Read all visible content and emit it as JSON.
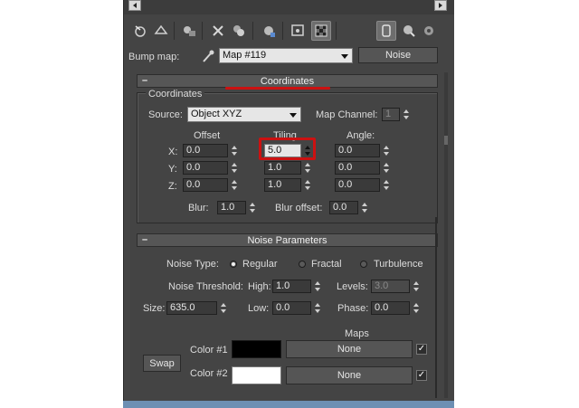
{
  "colors": {
    "panel": "#444444",
    "highlight_red": "#cc1111",
    "taskbar": "#6d8fb3"
  },
  "toolbar": {
    "icons": [
      "go-to-parent-icon",
      "show-end-result-icon",
      "put-to-library-icon",
      "delete-map-icon",
      "make-unique-icon",
      "assign-material-icon",
      "show-in-viewport-icon",
      "background-icon",
      "sample-type-icon",
      "material-map-navigator-icon",
      "options-icon",
      "go-forward-icon"
    ]
  },
  "bump": {
    "label": "Bump map:",
    "value": "Map #119",
    "type_button": "Noise"
  },
  "coordinates": {
    "rollout_title": "Coordinates",
    "group_title": "Coordinates",
    "source_label": "Source:",
    "source_value": "Object XYZ",
    "map_channel_label": "Map Channel:",
    "map_channel_value": "1",
    "col_offset": "Offset",
    "col_tiling": "Tiling",
    "col_angle": "Angle:",
    "row_x": "X:",
    "row_y": "Y:",
    "row_z": "Z:",
    "offset_x": "0.0",
    "offset_y": "0.0",
    "offset_z": "0.0",
    "tiling_x": "5.0",
    "tiling_y": "1.0",
    "tiling_z": "1.0",
    "angle_x": "0.0",
    "angle_y": "0.0",
    "angle_z": "0.0",
    "blur_label": "Blur:",
    "blur_value": "1.0",
    "blur_offset_label": "Blur offset:",
    "blur_offset_value": "0.0"
  },
  "noise": {
    "rollout_title": "Noise Parameters",
    "type_label": "Noise Type:",
    "type_regular": "Regular",
    "type_fractal": "Fractal",
    "type_turbulence": "Turbulence",
    "selected_type": "Regular",
    "threshold_label": "Noise Threshold:",
    "high_label": "High:",
    "high_value": "1.0",
    "levels_label": "Levels:",
    "levels_value": "3.0",
    "size_label": "Size:",
    "size_value": "635.0",
    "low_label": "Low:",
    "low_value": "0.0",
    "phase_label": "Phase:",
    "phase_value": "0.0",
    "maps_label": "Maps",
    "swap_label": "Swap",
    "color1_label": "Color #1",
    "color1": "#000000",
    "color1_map": "None",
    "color2_label": "Color #2",
    "color2": "#ffffff",
    "color2_map": "None"
  }
}
